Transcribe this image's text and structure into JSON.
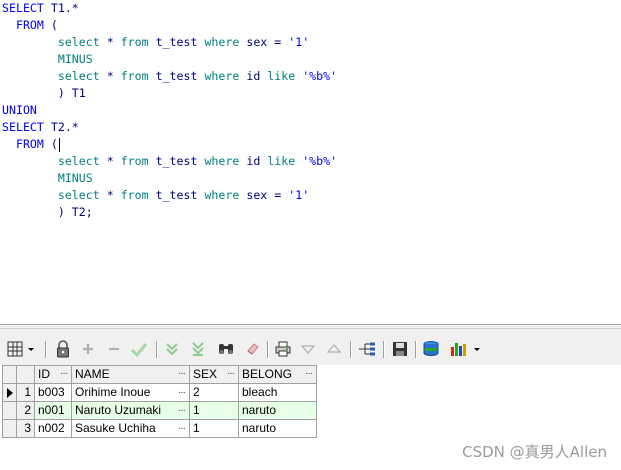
{
  "editor": {
    "lines": [
      [
        {
          "t": "SELECT",
          "c": "kw"
        },
        {
          "t": " T1.*",
          "c": "id"
        }
      ],
      [
        {
          "t": "  FROM",
          "c": "kw"
        },
        {
          "t": " (",
          "c": "sym"
        }
      ],
      [
        {
          "t": "        ",
          "c": "sym"
        },
        {
          "t": "select",
          "c": "kw2"
        },
        {
          "t": " * ",
          "c": "sym"
        },
        {
          "t": "from",
          "c": "kw2"
        },
        {
          "t": " t_test ",
          "c": "id"
        },
        {
          "t": "where",
          "c": "kw2"
        },
        {
          "t": " sex = ",
          "c": "id"
        },
        {
          "t": "'1'",
          "c": "str"
        }
      ],
      [
        {
          "t": "        ",
          "c": "sym"
        },
        {
          "t": "MINUS",
          "c": "kw2"
        }
      ],
      [
        {
          "t": "        ",
          "c": "sym"
        },
        {
          "t": "select",
          "c": "kw2"
        },
        {
          "t": " * ",
          "c": "sym"
        },
        {
          "t": "from",
          "c": "kw2"
        },
        {
          "t": " t_test ",
          "c": "id"
        },
        {
          "t": "where",
          "c": "kw2"
        },
        {
          "t": " id ",
          "c": "id"
        },
        {
          "t": "like",
          "c": "kw2"
        },
        {
          "t": " ",
          "c": "id"
        },
        {
          "t": "'%b%'",
          "c": "str"
        }
      ],
      [
        {
          "t": "        ) T1",
          "c": "id"
        }
      ],
      [
        {
          "t": "UNION",
          "c": "kw"
        }
      ],
      [
        {
          "t": "SELECT",
          "c": "kw"
        },
        {
          "t": " T2.*",
          "c": "id"
        }
      ],
      [
        {
          "t": "  FROM",
          "c": "kw"
        },
        {
          "t": " (",
          "c": "sym"
        },
        {
          "t": "",
          "c": "caret"
        }
      ],
      [
        {
          "t": "        ",
          "c": "sym"
        },
        {
          "t": "select",
          "c": "kw2"
        },
        {
          "t": " * ",
          "c": "sym"
        },
        {
          "t": "from",
          "c": "kw2"
        },
        {
          "t": " t_test ",
          "c": "id"
        },
        {
          "t": "where",
          "c": "kw2"
        },
        {
          "t": " id ",
          "c": "id"
        },
        {
          "t": "like",
          "c": "kw2"
        },
        {
          "t": " ",
          "c": "id"
        },
        {
          "t": "'%b%'",
          "c": "str"
        }
      ],
      [
        {
          "t": "        ",
          "c": "sym"
        },
        {
          "t": "MINUS",
          "c": "kw2"
        }
      ],
      [
        {
          "t": "        ",
          "c": "sym"
        },
        {
          "t": "select",
          "c": "kw2"
        },
        {
          "t": " * ",
          "c": "sym"
        },
        {
          "t": "from",
          "c": "kw2"
        },
        {
          "t": " t_test ",
          "c": "id"
        },
        {
          "t": "where",
          "c": "kw2"
        },
        {
          "t": " sex = ",
          "c": "id"
        },
        {
          "t": "'1'",
          "c": "str"
        }
      ],
      [
        {
          "t": "        ) T2;",
          "c": "id"
        }
      ]
    ]
  },
  "toolbar": {
    "buttons": [
      {
        "name": "grid-menu-icon"
      },
      {
        "name": "lock-icon"
      },
      {
        "name": "add-record-icon"
      },
      {
        "name": "delete-record-icon"
      },
      {
        "name": "post-changes-icon"
      },
      {
        "name": "fetch-next-page-icon"
      },
      {
        "name": "fetch-last-page-icon"
      },
      {
        "name": "find-binoculars-icon"
      },
      {
        "name": "clear-eraser-icon"
      },
      {
        "name": "print-icon"
      },
      {
        "name": "filter-down-icon"
      },
      {
        "name": "filter-up-icon"
      },
      {
        "name": "query-tree-icon"
      },
      {
        "name": "save-icon"
      },
      {
        "name": "export-disk-icon"
      },
      {
        "name": "chart-icon"
      }
    ],
    "colors": {
      "green": "#3cb043",
      "gray": "#9a9a9a",
      "blue": "#1f4fa8",
      "red": "#d22"
    }
  },
  "grid": {
    "columns": [
      "ID",
      "NAME",
      "SEX",
      "BELONG"
    ],
    "rows": [
      {
        "index": "1",
        "id": "b003",
        "name": "Orihime Inoue",
        "sex": "2",
        "belong": "bleach",
        "current": true
      },
      {
        "index": "2",
        "id": "n001",
        "name": "Naruto Uzumaki",
        "sex": "1",
        "belong": "naruto",
        "current": false
      },
      {
        "index": "3",
        "id": "n002",
        "name": "Sasuke Uchiha",
        "sex": "1",
        "belong": "naruto",
        "current": false
      }
    ],
    "ellipsis": "···"
  },
  "watermark": "CSDN @真男人Allen"
}
